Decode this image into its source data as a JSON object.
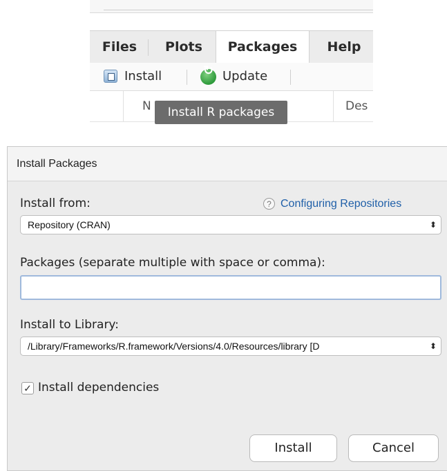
{
  "pane": {
    "tabs": [
      {
        "label": "Files"
      },
      {
        "label": "Plots"
      },
      {
        "label": "Packages"
      },
      {
        "label": "Help"
      }
    ],
    "toolbar": {
      "install_label": "Install",
      "update_label": "Update"
    },
    "columns": {
      "name": "N",
      "description": "Des"
    },
    "tooltip": "Install R packages"
  },
  "dialog": {
    "title": "Install Packages",
    "install_from_label": "Install from:",
    "help_icon": "question-icon",
    "help_link": "Configuring Repositories",
    "install_from_value": "Repository (CRAN)",
    "packages_label": "Packages (separate multiple with space or comma):",
    "packages_value": "",
    "library_label": "Install to Library:",
    "library_value": "/Library/Frameworks/R.framework/Versions/4.0/Resources/library [D",
    "dependencies_label": "Install dependencies",
    "dependencies_checked": true,
    "install_button": "Install",
    "cancel_button": "Cancel"
  }
}
